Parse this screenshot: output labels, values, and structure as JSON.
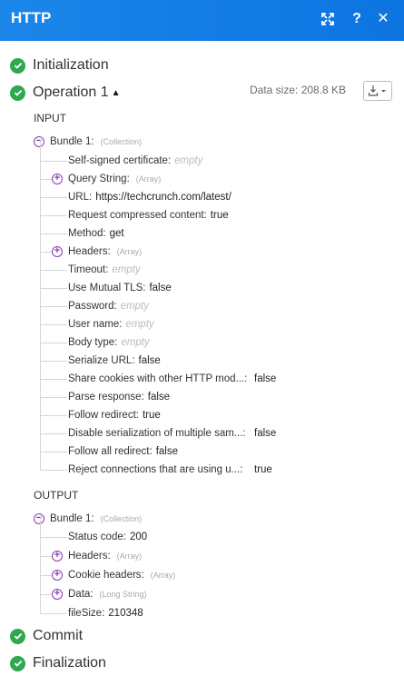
{
  "header": {
    "title": "HTTP",
    "icons": [
      "expand-icon",
      "help-icon",
      "close-icon"
    ],
    "help_glyph": "?",
    "close_glyph": "✕"
  },
  "colors": {
    "header": "#0d74e0",
    "success": "#2fa84f",
    "accent": "#8a39b5"
  },
  "steps": {
    "initialization": "Initialization",
    "operation": "Operation 1",
    "commit": "Commit",
    "finalization": "Finalization"
  },
  "data_size": "Data size: 208.8 KB",
  "input": {
    "heading": "INPUT",
    "bundle": {
      "label": "Bundle 1",
      "type": "(Collection)"
    },
    "items": [
      {
        "key": "Self-signed certificate",
        "value": "empty",
        "empty": true
      },
      {
        "key": "Query String",
        "type": "(Array)",
        "expandable": true
      },
      {
        "key": "URL",
        "value": "https://techcrunch.com/latest/"
      },
      {
        "key": "Request compressed content",
        "value": "true"
      },
      {
        "key": "Method",
        "value": "get"
      },
      {
        "key": "Headers",
        "type": "(Array)",
        "expandable": true
      },
      {
        "key": "Timeout",
        "value": "empty",
        "empty": true
      },
      {
        "key": "Use Mutual TLS",
        "value": "false"
      },
      {
        "key": "Password",
        "value": "empty",
        "empty": true
      },
      {
        "key": "User name",
        "value": "empty",
        "empty": true
      },
      {
        "key": "Body type",
        "value": "empty",
        "empty": true
      },
      {
        "key": "Serialize URL",
        "value": "false"
      },
      {
        "key": "Share cookies with other HTTP mod...",
        "value": "false"
      },
      {
        "key": "Parse response",
        "value": "false"
      },
      {
        "key": "Follow redirect",
        "value": "true"
      },
      {
        "key": "Disable serialization of multiple sam...",
        "value": "false"
      },
      {
        "key": "Follow all redirect",
        "value": "false"
      },
      {
        "key": "Reject connections that are using u...",
        "value": "true"
      }
    ]
  },
  "output": {
    "heading": "OUTPUT",
    "bundle": {
      "label": "Bundle 1",
      "type": "(Collection)"
    },
    "items": [
      {
        "key": "Status code",
        "value": "200"
      },
      {
        "key": "Headers",
        "type": "(Array)",
        "expandable": true
      },
      {
        "key": "Cookie headers",
        "type": "(Array)",
        "expandable": true
      },
      {
        "key": "Data",
        "type": "(Long String)",
        "expandable": true
      },
      {
        "key": "fileSize",
        "value": "210348"
      }
    ]
  }
}
